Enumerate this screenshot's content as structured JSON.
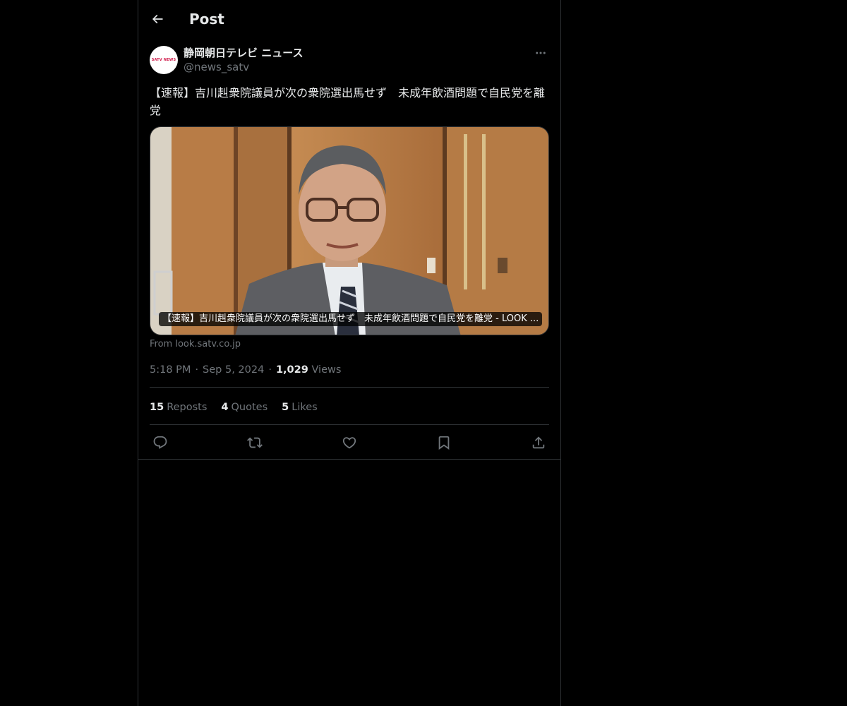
{
  "header": {
    "title": "Post",
    "back_icon": "arrow-left-icon"
  },
  "author": {
    "display_name": "静岡朝日テレビ ニュース",
    "handle": "@news_satv",
    "avatar_logo_text": "SATV NEWS"
  },
  "post": {
    "text": "【速報】吉川赳衆院議員が次の衆院選出馬せず　未成年飲酒問題で自民党を離党",
    "media_caption": "【速報】吉川赳衆院議員が次の衆院選出馬せず　未成年飲酒問題で自民党を離党 - LOOK ...",
    "source": "From look.satv.co.jp",
    "time": "5:18 PM",
    "date": "Sep 5, 2024",
    "views_count": "1,029",
    "views_label": "Views"
  },
  "stats": {
    "reposts_count": "15",
    "reposts_label": "Reposts",
    "quotes_count": "4",
    "quotes_label": "Quotes",
    "likes_count": "5",
    "likes_label": "Likes"
  },
  "actions": [
    "reply-icon",
    "repost-icon",
    "like-icon",
    "bookmark-icon",
    "share-icon"
  ],
  "colors": {
    "background": "#000000",
    "text": "#e7e9ea",
    "secondary_text": "#71767b",
    "border": "#2f3336",
    "logo_accent": "#d01a4a"
  }
}
